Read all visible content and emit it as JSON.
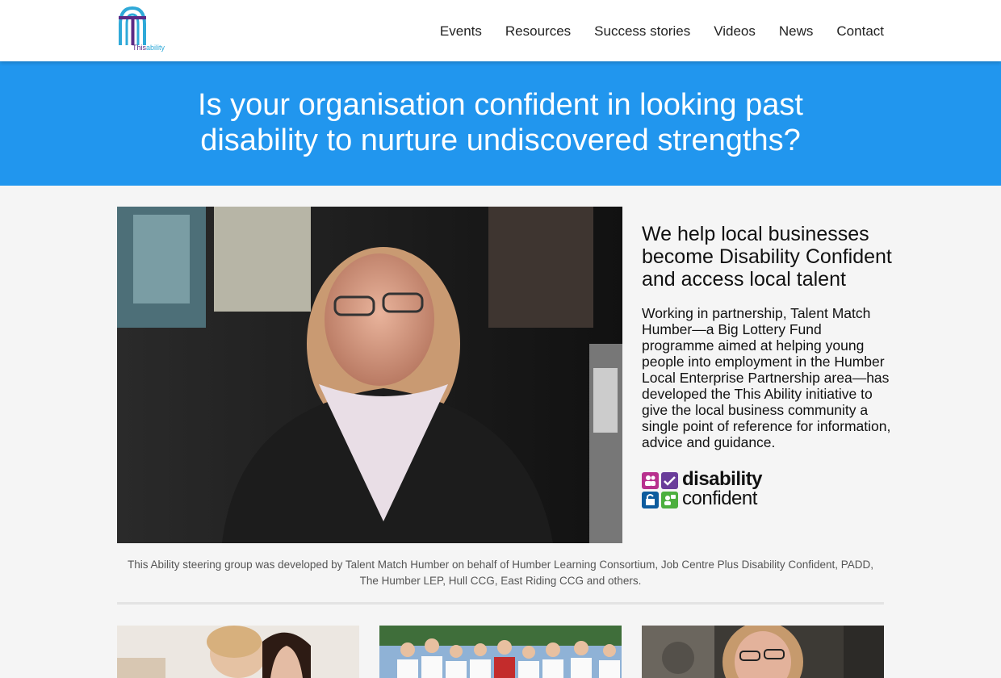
{
  "brand": {
    "logo_text_dark": "This",
    "logo_text_light": "ability",
    "colors": {
      "purple": "#5b2a86",
      "cyan": "#2fa9d8"
    }
  },
  "nav": {
    "items": [
      "Events",
      "Resources",
      "Success stories",
      "Videos",
      "News",
      "Contact"
    ]
  },
  "hero": {
    "line1": "Is your organisation confident in looking past",
    "line2": "disability to nurture undiscovered strengths?",
    "bg_color": "#2196ee"
  },
  "intro": {
    "heading": "We help local businesses become Disability Confident and access local talent",
    "body": "Working in partnership, Talent Match Humber—a Big Lottery Fund programme aimed at helping young people into employment in the Humber Local Enterprise Partnership area—has developed the This Ability initiative to give the local business community a single point of reference for information, advice and guidance."
  },
  "badge": {
    "word1": "disability",
    "word2": "confident",
    "icon_names": [
      "people-icon",
      "tick-icon",
      "lock-icon",
      "person-speech-icon"
    ],
    "colors": [
      "#b8318e",
      "#6a3d9a",
      "#0d5c9e",
      "#4caf3e"
    ]
  },
  "caption": {
    "text": "This Ability steering group was developed by Talent Match Humber on behalf of Humber Learning Consortium, Job Centre Plus Disability Confident, PADD, The Humber LEP, Hull CCG, East Riding CCG and others."
  },
  "cards": [
    {
      "name": "card-photo-meeting"
    },
    {
      "name": "card-photo-group"
    },
    {
      "name": "card-photo-portrait"
    }
  ]
}
